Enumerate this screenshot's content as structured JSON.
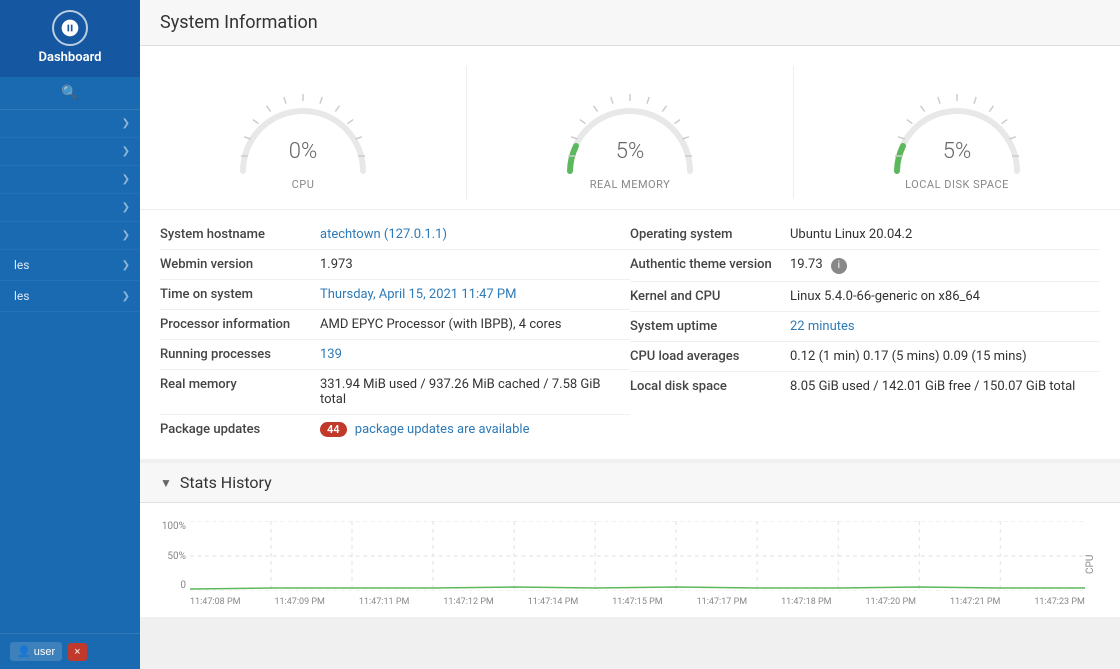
{
  "sidebar": {
    "dashboard_label": "Dashboard",
    "search_placeholder": "Search",
    "nav_items": [
      {
        "label": "",
        "id": "nav1"
      },
      {
        "label": "",
        "id": "nav2"
      },
      {
        "label": "",
        "id": "nav3"
      },
      {
        "label": "",
        "id": "nav4"
      },
      {
        "label": "",
        "id": "nav5"
      },
      {
        "label": "les",
        "id": "nav6"
      },
      {
        "label": "les",
        "id": "nav7"
      }
    ],
    "user_label": "user",
    "logout_label": "×"
  },
  "system_info": {
    "title": "System Information",
    "gauges": [
      {
        "id": "cpu",
        "value": "0%",
        "label": "CPU",
        "arc_value": 0
      },
      {
        "id": "memory",
        "value": "5%",
        "label": "REAL MEMORY",
        "arc_value": 5
      },
      {
        "id": "disk",
        "value": "5%",
        "label": "LOCAL DISK SPACE",
        "arc_value": 5
      }
    ],
    "rows_left": [
      {
        "label": "System hostname",
        "value": "atechtown (127.0.1.1)",
        "link": true
      },
      {
        "label": "Webmin version",
        "value": "1.973",
        "link": false
      },
      {
        "label": "Time on system",
        "value": "Thursday, April 15, 2021 11:47 PM",
        "link": true
      },
      {
        "label": "Processor information",
        "value": "AMD EPYC Processor (with IBPB), 4 cores",
        "link": false
      },
      {
        "label": "Running processes",
        "value": "139",
        "link": true
      },
      {
        "label": "Real memory",
        "value": "331.94 MiB used / 937.26 MiB cached / 7.58 GiB total",
        "link": false
      },
      {
        "label": "Package updates",
        "value": " package updates are available",
        "link": true,
        "badge": "44"
      }
    ],
    "rows_right": [
      {
        "label": "Operating system",
        "value": "Ubuntu Linux 20.04.2",
        "link": false
      },
      {
        "label": "Authentic theme version",
        "value": "19.73",
        "link": false,
        "info_icon": true
      },
      {
        "label": "Kernel and CPU",
        "value": "Linux 5.4.0-66-generic on x86_64",
        "link": false
      },
      {
        "label": "System uptime",
        "value": "22 minutes",
        "link": true
      },
      {
        "label": "CPU load averages",
        "value": "0.12 (1 min) 0.17 (5 mins) 0.09 (15 mins)",
        "link": false
      },
      {
        "label": "Local disk space",
        "value": "8.05 GiB used / 142.01 GiB free / 150.07 GiB total",
        "link": false
      }
    ]
  },
  "stats_history": {
    "title": "Stats History",
    "chart": {
      "y_label": "CPU",
      "y_axis": [
        "100%",
        "50%",
        "0"
      ],
      "x_labels": [
        "11:47:08 PM",
        "11:47:09 PM",
        "11:47:11 PM",
        "11:47:12 PM",
        "11:47:14 PM",
        "11:47:15 PM",
        "11:47:17 PM",
        "11:47:18 PM",
        "11:47:20 PM",
        "11:47:21 PM",
        "11:47:23 PM"
      ]
    }
  }
}
